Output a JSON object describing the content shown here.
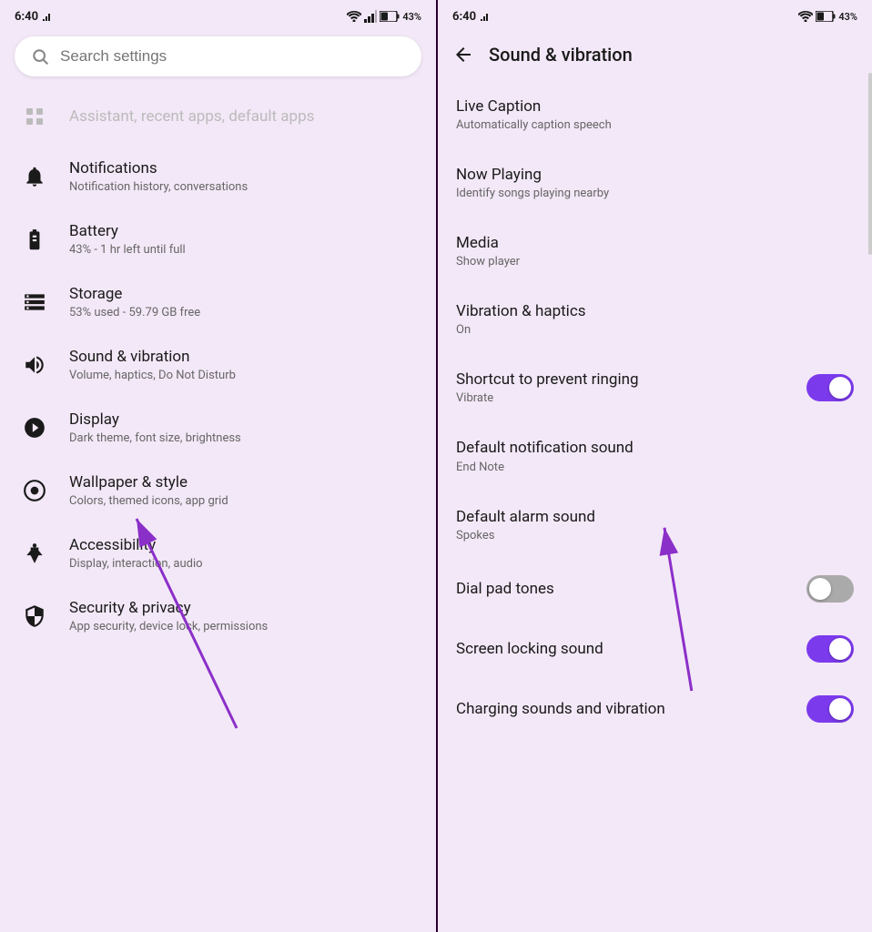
{
  "left": {
    "status": {
      "time": "6:40",
      "battery": "43%"
    },
    "search": {
      "placeholder": "Search settings"
    },
    "items": [
      {
        "id": "top-faded",
        "title": "Assistant, recent apps, default apps",
        "subtitle": "",
        "icon": "grid-icon",
        "faded": true
      },
      {
        "id": "notifications",
        "title": "Notifications",
        "subtitle": "Notification history, conversations",
        "icon": "bell-icon",
        "faded": false
      },
      {
        "id": "battery",
        "title": "Battery",
        "subtitle": "43% - 1 hr left until full",
        "icon": "battery-icon",
        "faded": false
      },
      {
        "id": "storage",
        "title": "Storage",
        "subtitle": "53% used - 59.79 GB free",
        "icon": "storage-icon",
        "faded": false
      },
      {
        "id": "sound",
        "title": "Sound & vibration",
        "subtitle": "Volume, haptics, Do Not Disturb",
        "icon": "sound-icon",
        "faded": false
      },
      {
        "id": "display",
        "title": "Display",
        "subtitle": "Dark theme, font size, brightness",
        "icon": "display-icon",
        "faded": false
      },
      {
        "id": "wallpaper",
        "title": "Wallpaper & style",
        "subtitle": "Colors, themed icons, app grid",
        "icon": "wallpaper-icon",
        "faded": false
      },
      {
        "id": "accessibility",
        "title": "Accessibility",
        "subtitle": "Display, interaction, audio",
        "icon": "accessibility-icon",
        "faded": false
      },
      {
        "id": "security",
        "title": "Security & privacy",
        "subtitle": "App security, device lock, permissions",
        "icon": "security-icon",
        "faded": false
      }
    ]
  },
  "right": {
    "status": {
      "time": "6:40",
      "battery": "43%"
    },
    "header": {
      "title": "Sound & vibration",
      "back_label": "←"
    },
    "items": [
      {
        "id": "live-caption",
        "title": "Live Caption",
        "subtitle": "Automatically caption speech",
        "toggle": null
      },
      {
        "id": "now-playing",
        "title": "Now Playing",
        "subtitle": "Identify songs playing nearby",
        "toggle": null
      },
      {
        "id": "media",
        "title": "Media",
        "subtitle": "Show player",
        "toggle": null
      },
      {
        "id": "vibration-haptics",
        "title": "Vibration & haptics",
        "subtitle": "On",
        "toggle": null
      },
      {
        "id": "shortcut-ringing",
        "title": "Shortcut to prevent ringing",
        "subtitle": "Vibrate",
        "toggle": "on"
      },
      {
        "id": "default-notification",
        "title": "Default notification sound",
        "subtitle": "End Note",
        "toggle": null
      },
      {
        "id": "default-alarm",
        "title": "Default alarm sound",
        "subtitle": "Spokes",
        "toggle": null
      },
      {
        "id": "dial-pad-tones",
        "title": "Dial pad tones",
        "subtitle": "",
        "toggle": "off"
      },
      {
        "id": "screen-locking",
        "title": "Screen locking sound",
        "subtitle": "",
        "toggle": "on"
      },
      {
        "id": "charging-sounds",
        "title": "Charging sounds and vibration",
        "subtitle": "",
        "toggle": "on"
      }
    ]
  }
}
